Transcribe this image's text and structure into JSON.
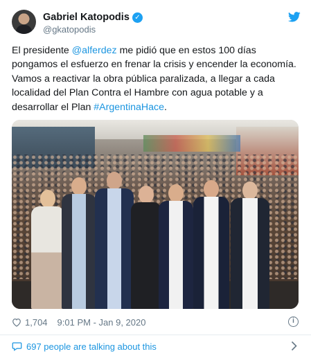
{
  "tweet": {
    "author": {
      "display_name": "Gabriel Katopodis",
      "handle": "@gkatopodis",
      "verified": true
    },
    "text_segments": [
      {
        "text": "El presidente ",
        "type": "text"
      },
      {
        "text": "@alferdez",
        "type": "mention"
      },
      {
        "text": " me pidió que en estos 100 días pongamos el esfuerzo en frenar la crisis y encender la economía. Vamos a reactivar la obra pública paralizada, a llegar a cada localidad del Plan Contra el Hambre con agua potable y a desarrollar el Plan ",
        "type": "text"
      },
      {
        "text": "#ArgentinaHace",
        "type": "hashtag"
      },
      {
        "text": ".",
        "type": "text"
      }
    ],
    "like_count": "1,704",
    "timestamp": "9:01 PM - Jan 9, 2020",
    "talking_text": "697 people are talking about this"
  },
  "icons": {
    "verified": "verified-badge-icon",
    "brand": "twitter-bird-icon",
    "like": "heart-icon",
    "info": "info-icon",
    "comment": "comment-bubble-icon",
    "chevron": "chevron-right-icon"
  },
  "colors": {
    "link": "#1b95e0",
    "brand": "#1da1f2",
    "muted": "#657786",
    "text": "#14171a",
    "divider": "#e6ecf0"
  }
}
